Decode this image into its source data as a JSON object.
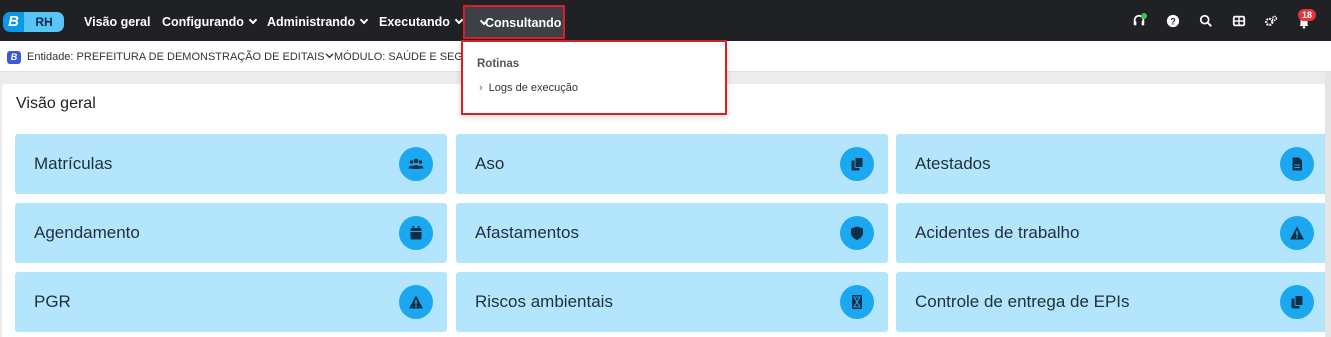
{
  "app": {
    "logo_b": "B",
    "logo_rh": "RH"
  },
  "nav": {
    "items": [
      {
        "label": "Visão geral",
        "has_chevron": false
      },
      {
        "label": "Configurando",
        "has_chevron": true
      },
      {
        "label": "Administrando",
        "has_chevron": true
      },
      {
        "label": "Executando",
        "has_chevron": true
      }
    ],
    "active": {
      "label": "Consultando",
      "has_chevron": true
    },
    "icons": [
      "headset-icon",
      "help-icon",
      "search-icon",
      "apps-grid-icon",
      "settings-icon",
      "bell-icon"
    ],
    "notification_count": "18"
  },
  "entity_bar": {
    "badge": "B",
    "entity": "Entidade: PREFEITURA DE DEMONSTRAÇÃO DE EDITAIS",
    "module": "MÓDULO: SAÚDE E SEGU"
  },
  "dropdown": {
    "heading": "Rotinas",
    "items": [
      {
        "label": "Logs de execução"
      }
    ]
  },
  "main": {
    "title": "Visão geral",
    "cards": [
      {
        "label": "Matrículas",
        "icon": "users-icon"
      },
      {
        "label": "Aso",
        "icon": "copy-icon"
      },
      {
        "label": "Atestados",
        "icon": "document-icon"
      },
      {
        "label": "Agendamento",
        "icon": "calendar-icon"
      },
      {
        "label": "Afastamentos",
        "icon": "shield-icon"
      },
      {
        "label": "Acidentes de trabalho",
        "icon": "warning-icon"
      },
      {
        "label": "PGR",
        "icon": "warning-icon"
      },
      {
        "label": "Riscos ambientais",
        "icon": "hourglass-icon"
      },
      {
        "label": "Controle de entrega de EPIs",
        "icon": "copy-icon"
      }
    ]
  },
  "colors": {
    "topbar": "#1f2124",
    "card_bg": "#b3e6fd",
    "card_icon_bg": "#1ba8f0",
    "highlight_border": "#d9202a"
  }
}
